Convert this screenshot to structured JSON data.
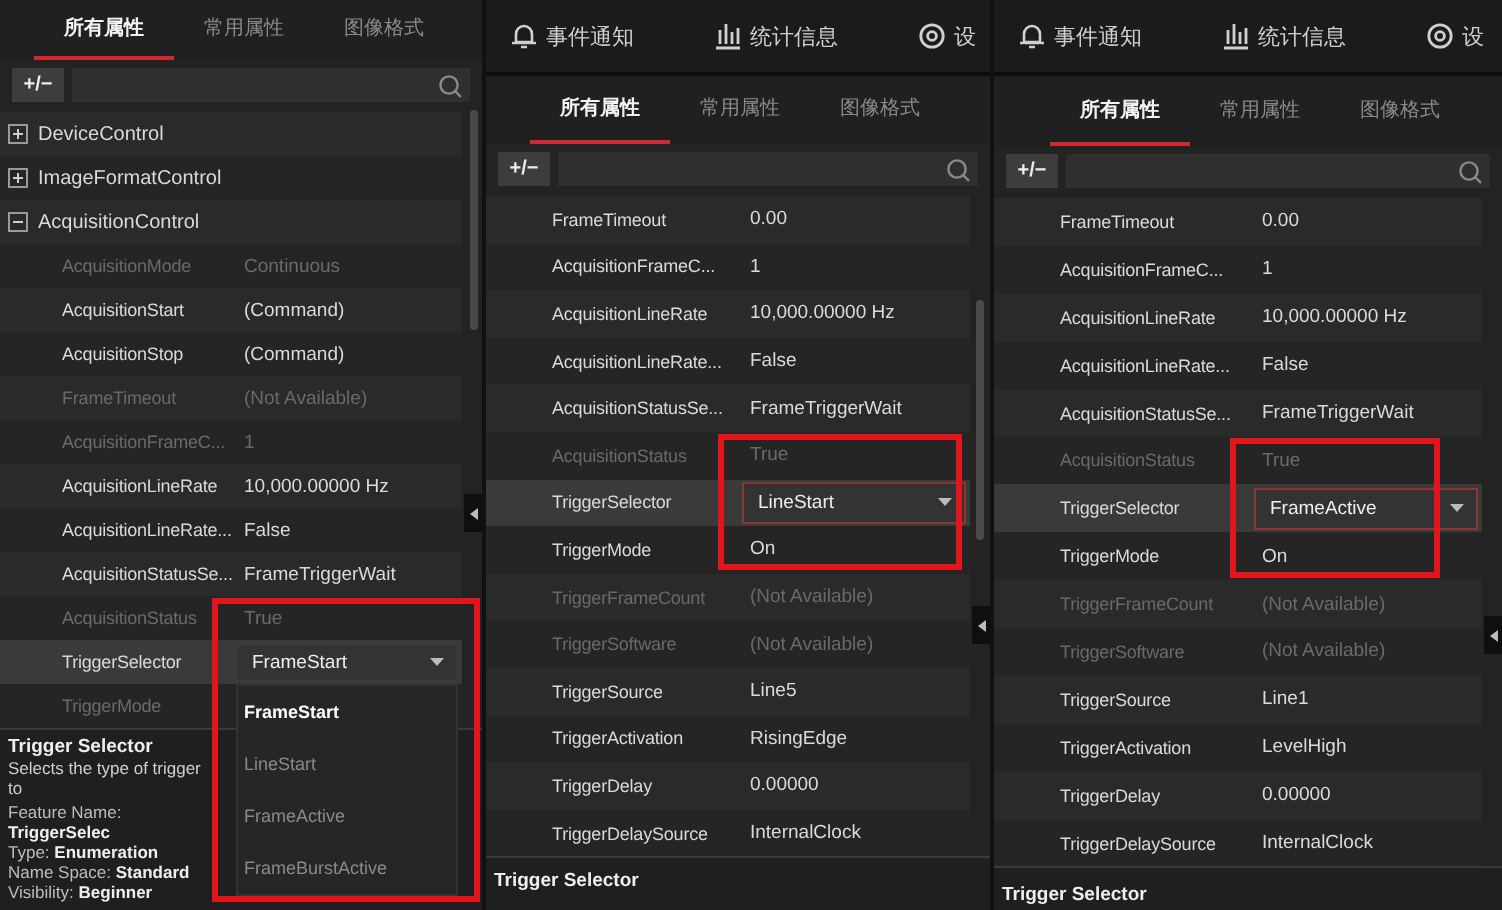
{
  "panels": [
    {
      "tabs": [
        {
          "label": "所有属性",
          "selected": true
        },
        {
          "label": "常用属性",
          "selected": false
        },
        {
          "label": "图像格式",
          "selected": false
        }
      ],
      "search": {
        "toggle_label": "+/−"
      },
      "tree": [
        {
          "kind": "group",
          "label": "DeviceControl",
          "expanded": false
        },
        {
          "kind": "group",
          "label": "ImageFormatControl",
          "expanded": false
        },
        {
          "kind": "group",
          "label": "AcquisitionControl",
          "expanded": true,
          "children": [
            {
              "kind": "property",
              "name": "AcquisitionMode",
              "value": "Continuous",
              "disabled": true,
              "selected": false
            },
            {
              "kind": "property",
              "name": "AcquisitionStart",
              "value": "(Command)",
              "disabled": false,
              "selected": false
            },
            {
              "kind": "property",
              "name": "AcquisitionStop",
              "value": "(Command)",
              "disabled": false,
              "selected": false
            },
            {
              "kind": "property",
              "name": "FrameTimeout",
              "value": "(Not Available)",
              "disabled": true,
              "selected": false
            },
            {
              "kind": "property",
              "name": "AcquisitionFrameC...",
              "value": "1",
              "disabled": true,
              "selected": false
            },
            {
              "kind": "property",
              "name": "AcquisitionLineRate",
              "value": "10,000.00000 Hz",
              "disabled": false,
              "selected": false
            },
            {
              "kind": "property",
              "name": "AcquisitionLineRate...",
              "value": "False",
              "disabled": false,
              "selected": false
            },
            {
              "kind": "property",
              "name": "AcquisitionStatusSe...",
              "value": "FrameTriggerWait",
              "disabled": false,
              "selected": false
            },
            {
              "kind": "property",
              "name": "AcquisitionStatus",
              "value": "True",
              "disabled": true,
              "selected": false
            },
            {
              "kind": "combo",
              "name": "TriggerSelector",
              "value": "FrameStart",
              "disabled": false,
              "selected": true,
              "options": [
                {
                  "label": "FrameStart",
                  "selected": true
                },
                {
                  "label": "LineStart",
                  "selected": false
                },
                {
                  "label": "FrameActive",
                  "selected": false
                },
                {
                  "label": "FrameBurstActive",
                  "selected": false
                }
              ]
            },
            {
              "kind": "property",
              "name": "TriggerMode",
              "disabled": true,
              "selected": false
            }
          ]
        }
      ],
      "description": {
        "title": "Trigger Selector",
        "summary": "Selects the type of trigger to",
        "details": [
          "Feature Name: **TriggerSelec**",
          "Type: **Enumeration**",
          "Name Space: **Standard**",
          "Visibility: **Beginner**"
        ]
      },
      "highlight": true
    },
    {
      "toolbar": [
        {
          "kind": "bell",
          "label": "事件通知"
        },
        {
          "kind": "chart",
          "label": "统计信息"
        },
        {
          "kind": "gear",
          "label": "设"
        }
      ],
      "tabs": [
        {
          "label": "所有属性",
          "selected": true
        },
        {
          "label": "常用属性",
          "selected": false
        },
        {
          "label": "图像格式",
          "selected": false
        }
      ],
      "search": {
        "toggle_label": "+/−"
      },
      "tree": [
        {
          "kind": "property",
          "name": "FrameTimeout",
          "value": "0.00",
          "disabled": false,
          "selected": false
        },
        {
          "kind": "property",
          "name": "AcquisitionFrameC...",
          "value": "1",
          "disabled": false,
          "selected": false
        },
        {
          "kind": "property",
          "name": "AcquisitionLineRate",
          "value": "10,000.00000 Hz",
          "disabled": false,
          "selected": false
        },
        {
          "kind": "property",
          "name": "AcquisitionLineRate...",
          "value": "False",
          "disabled": false,
          "selected": false
        },
        {
          "kind": "property",
          "name": "AcquisitionStatusSe...",
          "value": "FrameTriggerWait",
          "disabled": false,
          "selected": false
        },
        {
          "kind": "property",
          "name": "AcquisitionStatus",
          "value": "True",
          "disabled": true,
          "selected": false
        },
        {
          "kind": "combo",
          "name": "TriggerSelector",
          "value": "LineStart",
          "disabled": false,
          "selected": true
        },
        {
          "kind": "property",
          "name": "TriggerMode",
          "value": "On",
          "disabled": false,
          "selected": false
        },
        {
          "kind": "property",
          "name": "TriggerFrameCount",
          "value": "(Not Available)",
          "disabled": true,
          "selected": false
        },
        {
          "kind": "property",
          "name": "TriggerSoftware",
          "value": "(Not Available)",
          "disabled": true,
          "selected": false
        },
        {
          "kind": "property",
          "name": "TriggerSource",
          "value": "Line5",
          "disabled": false,
          "selected": false
        },
        {
          "kind": "property",
          "name": "TriggerActivation",
          "value": "RisingEdge",
          "disabled": false,
          "selected": false
        },
        {
          "kind": "property",
          "name": "TriggerDelay",
          "value": "0.00000",
          "disabled": false,
          "selected": false
        },
        {
          "kind": "property",
          "name": "TriggerDelaySource",
          "value": "InternalClock",
          "disabled": false,
          "selected": false
        }
      ],
      "description": {
        "title": "Trigger Selector"
      },
      "highlight": true
    },
    {
      "toolbar": [
        {
          "kind": "bell",
          "label": "事件通知"
        },
        {
          "kind": "chart",
          "label": "统计信息"
        },
        {
          "kind": "gear",
          "label": "设"
        }
      ],
      "tabs": [
        {
          "label": "所有属性",
          "selected": true
        },
        {
          "label": "常用属性",
          "selected": false
        },
        {
          "label": "图像格式",
          "selected": false
        }
      ],
      "search": {
        "toggle_label": "+/−"
      },
      "tree": [
        {
          "kind": "property",
          "name": "FrameTimeout",
          "value": "0.00",
          "disabled": false,
          "selected": false
        },
        {
          "kind": "property",
          "name": "AcquisitionFrameC...",
          "value": "1",
          "disabled": false,
          "selected": false
        },
        {
          "kind": "property",
          "name": "AcquisitionLineRate",
          "value": "10,000.00000 Hz",
          "disabled": false,
          "selected": false
        },
        {
          "kind": "property",
          "name": "AcquisitionLineRate...",
          "value": "False",
          "disabled": false,
          "selected": false
        },
        {
          "kind": "property",
          "name": "AcquisitionStatusSe...",
          "value": "FrameTriggerWait",
          "disabled": false,
          "selected": false
        },
        {
          "kind": "property",
          "name": "AcquisitionStatus",
          "value": "True",
          "disabled": true,
          "selected": false
        },
        {
          "kind": "combo",
          "name": "TriggerSelector",
          "value": "FrameActive",
          "disabled": false,
          "selected": true
        },
        {
          "kind": "property",
          "name": "TriggerMode",
          "value": "On",
          "disabled": false,
          "selected": false
        },
        {
          "kind": "property",
          "name": "TriggerFrameCount",
          "value": "(Not Available)",
          "disabled": true,
          "selected": false
        },
        {
          "kind": "property",
          "name": "TriggerSoftware",
          "value": "(Not Available)",
          "disabled": true,
          "selected": false
        },
        {
          "kind": "property",
          "name": "TriggerSource",
          "value": "Line1",
          "disabled": false,
          "selected": false
        },
        {
          "kind": "property",
          "name": "TriggerActivation",
          "value": "LevelHigh",
          "disabled": false,
          "selected": false
        },
        {
          "kind": "property",
          "name": "TriggerDelay",
          "value": "0.00000",
          "disabled": false,
          "selected": false
        },
        {
          "kind": "property",
          "name": "TriggerDelaySource",
          "value": "InternalClock",
          "disabled": false,
          "selected": false
        }
      ],
      "description": {
        "title": "Trigger Selector"
      },
      "highlight": true
    }
  ]
}
